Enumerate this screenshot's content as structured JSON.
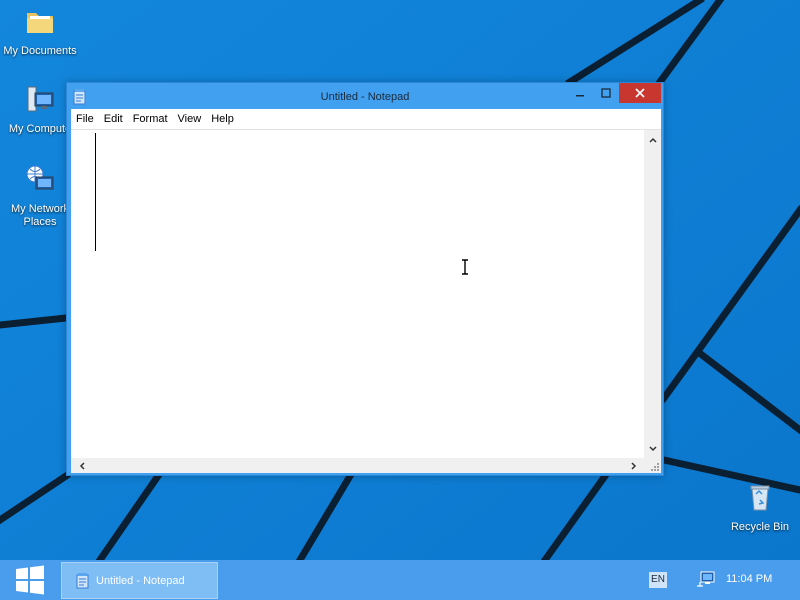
{
  "desktop": {
    "icons": [
      {
        "label": "My Documents",
        "icon": "folder-icon"
      },
      {
        "label": "My Compute",
        "icon": "computer-icon"
      },
      {
        "label": "My Network",
        "label2": "Places",
        "icon": "network-icon"
      },
      {
        "label": "Recycle Bin",
        "icon": "recycle-bin-icon"
      }
    ]
  },
  "window": {
    "title": "Untitled - Notepad",
    "menu": [
      "File",
      "Edit",
      "Format",
      "View",
      "Help"
    ],
    "content": "",
    "close_color": "#c7372f"
  },
  "taskbar": {
    "task_label": "Untitled - Notepad",
    "language": "EN",
    "clock": "11:04 PM"
  },
  "colors": {
    "desktop_background": "#0f7fd6",
    "taskbar": "#4a9ded",
    "window_frame": "#42a0f0"
  }
}
